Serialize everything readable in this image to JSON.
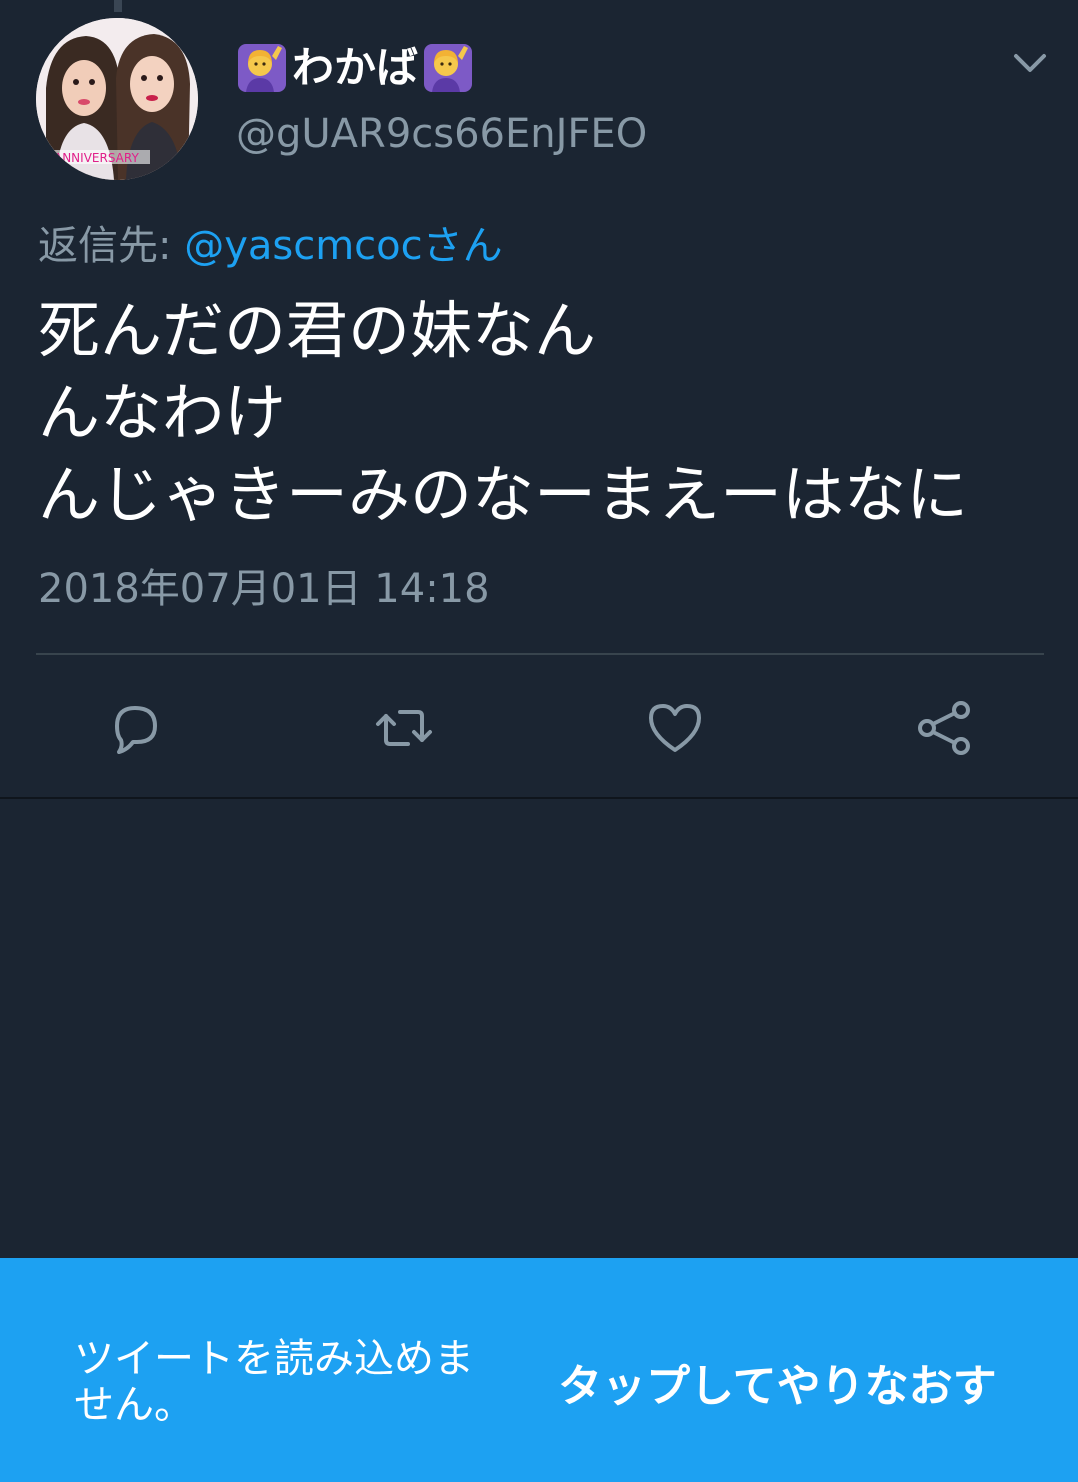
{
  "tweet": {
    "display_name": "わかば",
    "name_emoji_icon": "person-raising-hand-icon",
    "handle": "@gUAR9cs66EnJFEO",
    "avatar_text": "ANNIVERSARY",
    "reply_prefix": "返信先: ",
    "reply_to": "@yascmcocさん",
    "text_lines": [
      "死んだの君の妹なん",
      "んなわけ",
      "んじゃきーみのなーまえーはなに"
    ],
    "timestamp": "2018年07月01日 14:18"
  },
  "actions": {
    "reply_icon": "reply-icon",
    "retweet_icon": "retweet-icon",
    "like_icon": "heart-icon",
    "share_icon": "share-icon",
    "menu_icon": "chevron-down-icon"
  },
  "error_bar": {
    "message": "ツイートを読み込めません。",
    "retry_label": "タップしてやりなおす"
  },
  "colors": {
    "background": "#1b2532",
    "accent": "#1da1f2",
    "muted_text": "#8899a6",
    "text": "#ffffff"
  }
}
